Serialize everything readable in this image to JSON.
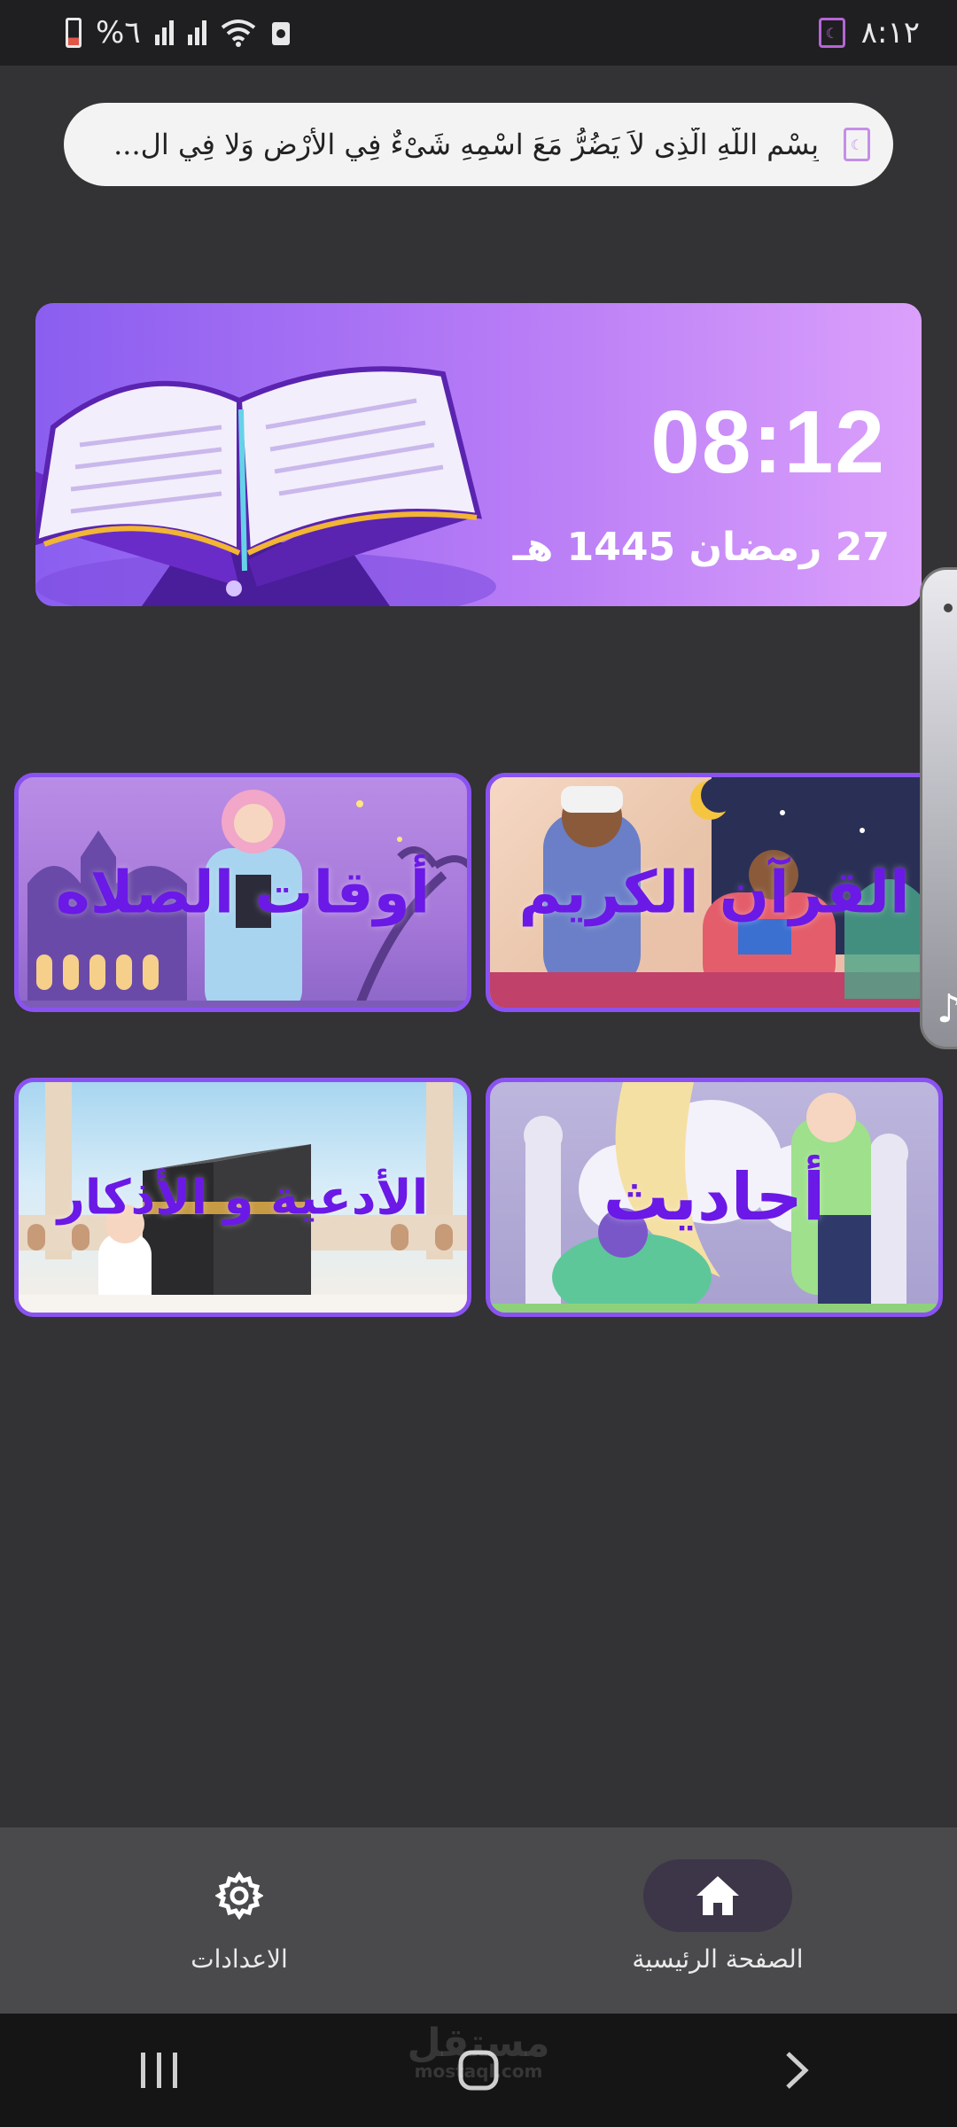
{
  "status_bar": {
    "time": "٨:١٢",
    "battery": "%٦"
  },
  "dhikr": {
    "text": "بِسْمِ اللَّهِ الَّذِى لاَ يَضُرُّ مَعَ اسْمِهِ شَىْءٌ فِي الأَرْضِ وَلا فِي ال..."
  },
  "hero": {
    "time": "08:12",
    "hijri_date": "27 رمضان 1445 هـ"
  },
  "cards": {
    "quran": "القرآن الكريم",
    "prayer_times": "أوقات الصلاه",
    "hadith": "أحاديث",
    "duaa_adhkar": "الأدعية و الأذكار"
  },
  "bottom_nav": {
    "home": "الصفحة الرئيسية",
    "settings": "الاعدادات"
  },
  "watermark": {
    "name": "مستقل",
    "domain": "mostaql.com"
  },
  "colors": {
    "accent": "#6b19e6",
    "card_border": "#8a52f0",
    "hero_start": "#8a5ef0",
    "hero_end": "#dba0fb",
    "background": "#333234"
  }
}
